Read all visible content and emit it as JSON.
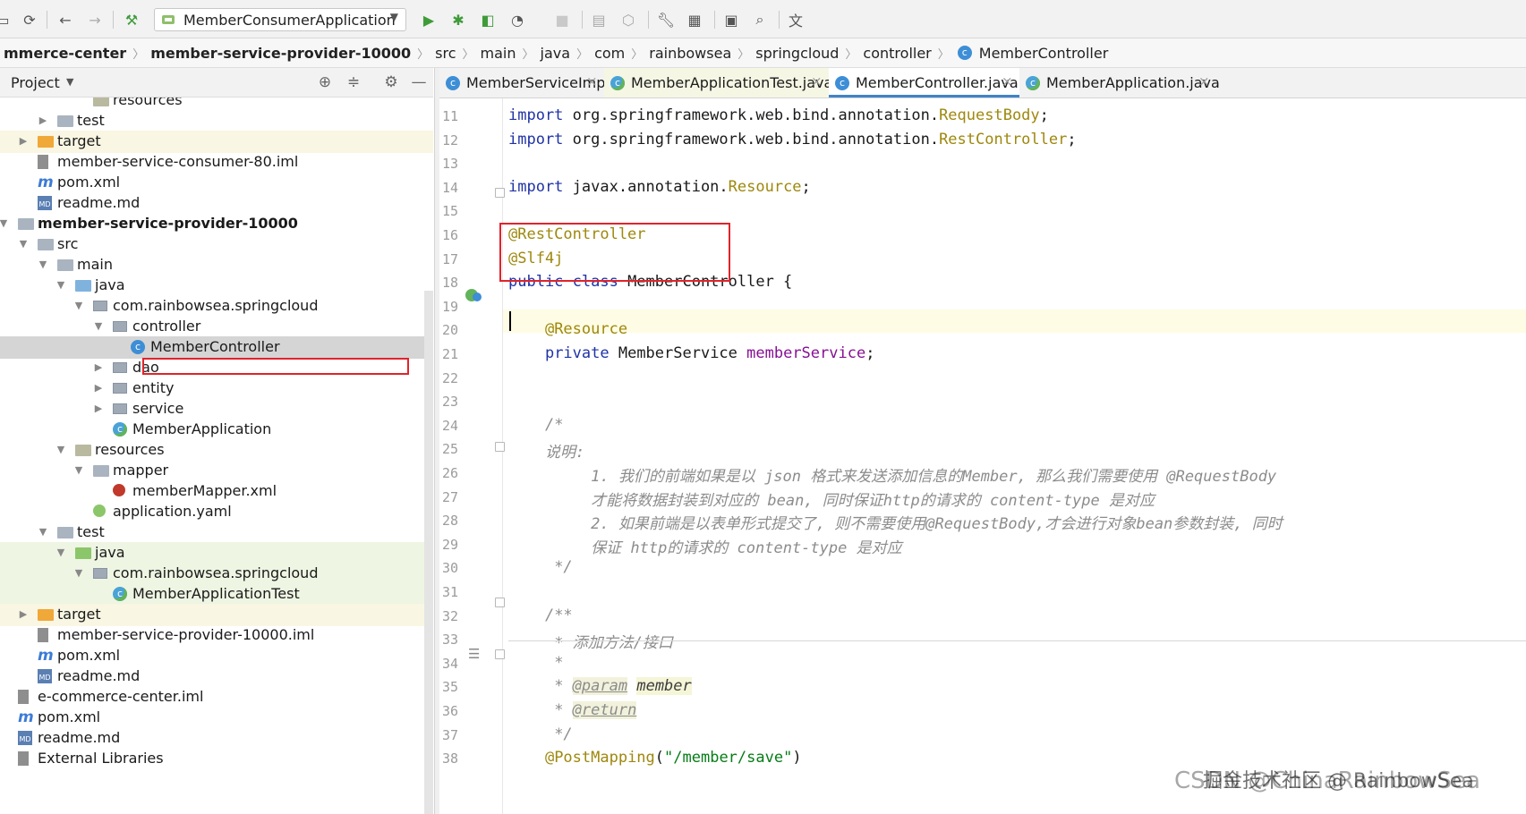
{
  "toolbar": {
    "run_config": "MemberConsumerApplication",
    "icons": [
      "save-all-icon",
      "sync-icon",
      "back-icon",
      "forward-icon",
      "build-icon",
      "run-icon",
      "debug-icon",
      "coverage-icon",
      "profile-icon",
      "stop-icon",
      "attach-icon",
      "deploy-icon",
      "settings-icon",
      "project-structure-icon",
      "terminal-icon",
      "search-icon",
      "translate-icon"
    ]
  },
  "breadcrumb": [
    "mmerce-center",
    "member-service-provider-10000",
    "src",
    "main",
    "java",
    "com",
    "rainbowsea",
    "springcloud",
    "controller",
    "MemberController"
  ],
  "project": {
    "title": "Project",
    "tree": [
      {
        "label": "resources",
        "depth": 4,
        "icon": "res",
        "arrow": ""
      },
      {
        "label": "test",
        "depth": 2,
        "icon": "folder",
        "arrow": "right"
      },
      {
        "label": "target",
        "depth": 1,
        "icon": "target",
        "arrow": "right",
        "hl": "target"
      },
      {
        "label": "member-service-consumer-80.iml",
        "depth": 1,
        "icon": "file",
        "arrow": ""
      },
      {
        "label": "pom.xml",
        "depth": 1,
        "icon": "m",
        "arrow": ""
      },
      {
        "label": "readme.md",
        "depth": 1,
        "icon": "md",
        "arrow": ""
      },
      {
        "label": "member-service-provider-10000",
        "depth": 0,
        "icon": "folder",
        "arrow": "down",
        "bold": true
      },
      {
        "label": "src",
        "depth": 1,
        "icon": "folder",
        "arrow": "down"
      },
      {
        "label": "main",
        "depth": 2,
        "icon": "folder",
        "arrow": "down"
      },
      {
        "label": "java",
        "depth": 3,
        "icon": "src",
        "arrow": "down"
      },
      {
        "label": "com.rainbowsea.springcloud",
        "depth": 4,
        "icon": "pkg",
        "arrow": "down"
      },
      {
        "label": "controller",
        "depth": 5,
        "icon": "pkg",
        "arrow": "down"
      },
      {
        "label": "MemberController",
        "depth": 6,
        "icon": "class",
        "arrow": "",
        "selected": true
      },
      {
        "label": "dao",
        "depth": 5,
        "icon": "pkg",
        "arrow": "right"
      },
      {
        "label": "entity",
        "depth": 5,
        "icon": "pkg",
        "arrow": "right"
      },
      {
        "label": "service",
        "depth": 5,
        "icon": "pkg",
        "arrow": "right"
      },
      {
        "label": "MemberApplication",
        "depth": 5,
        "icon": "spring",
        "arrow": ""
      },
      {
        "label": "resources",
        "depth": 3,
        "icon": "res",
        "arrow": "down"
      },
      {
        "label": "mapper",
        "depth": 4,
        "icon": "folder",
        "arrow": "down"
      },
      {
        "label": "memberMapper.xml",
        "depth": 5,
        "icon": "xml",
        "arrow": ""
      },
      {
        "label": "application.yaml",
        "depth": 4,
        "icon": "yaml",
        "arrow": ""
      },
      {
        "label": "test",
        "depth": 2,
        "icon": "folder",
        "arrow": "down"
      },
      {
        "label": "java",
        "depth": 3,
        "icon": "test",
        "arrow": "down",
        "hl": "test"
      },
      {
        "label": "com.rainbowsea.springcloud",
        "depth": 4,
        "icon": "pkg",
        "arrow": "down",
        "hl": "test"
      },
      {
        "label": "MemberApplicationTest",
        "depth": 5,
        "icon": "spring",
        "arrow": "",
        "hl": "test"
      },
      {
        "label": "target",
        "depth": 1,
        "icon": "target",
        "arrow": "right",
        "hl": "target"
      },
      {
        "label": "member-service-provider-10000.iml",
        "depth": 1,
        "icon": "file",
        "arrow": ""
      },
      {
        "label": "pom.xml",
        "depth": 1,
        "icon": "m",
        "arrow": ""
      },
      {
        "label": "readme.md",
        "depth": 1,
        "icon": "md",
        "arrow": ""
      },
      {
        "label": "e-commerce-center.iml",
        "depth": 0,
        "icon": "file",
        "arrow": ""
      },
      {
        "label": "pom.xml",
        "depth": 0,
        "icon": "m",
        "arrow": ""
      },
      {
        "label": "readme.md",
        "depth": 0,
        "icon": "md",
        "arrow": ""
      },
      {
        "label": "External Libraries",
        "depth": 0,
        "icon": "lib",
        "arrow": ""
      }
    ]
  },
  "tabs": [
    {
      "label": "MemberServiceImpl.java",
      "icon": "class",
      "state": "normal"
    },
    {
      "label": "MemberApplicationTest.java",
      "icon": "spring",
      "state": "modified"
    },
    {
      "label": "MemberController.java",
      "icon": "class",
      "state": "active"
    },
    {
      "label": "MemberApplication.java",
      "icon": "spring",
      "state": "normal"
    }
  ],
  "editor": {
    "line_numbers": [
      "11",
      "12",
      "13",
      "14",
      "15",
      "16",
      "17",
      "18",
      "19",
      "20",
      "21",
      "22",
      "23",
      "24",
      "25",
      "26",
      "27",
      "28",
      "29",
      "30",
      "31",
      "32",
      "33",
      "34",
      "35",
      "36",
      "37",
      "38"
    ],
    "lines": [
      [
        {
          "t": "import",
          "c": "kw"
        },
        {
          "t": " org.springframework.web.bind.annotation."
        },
        {
          "t": "RequestBody",
          "c": "ann"
        },
        {
          "t": ";"
        }
      ],
      [
        {
          "t": "import",
          "c": "kw"
        },
        {
          "t": " org.springframework.web.bind.annotation."
        },
        {
          "t": "RestController",
          "c": "ann"
        },
        {
          "t": ";"
        }
      ],
      [],
      [
        {
          "t": "import",
          "c": "kw"
        },
        {
          "t": " javax.annotation."
        },
        {
          "t": "Resource",
          "c": "ann"
        },
        {
          "t": ";"
        }
      ],
      [],
      [
        {
          "t": "@RestController",
          "c": "ann"
        }
      ],
      [
        {
          "t": "@Slf4j",
          "c": "ann"
        }
      ],
      [
        {
          "t": "public class",
          "c": "kw"
        },
        {
          "t": " MemberController {"
        }
      ],
      [],
      [
        {
          "t": "    "
        },
        {
          "t": "@Resource",
          "c": "ann"
        }
      ],
      [
        {
          "t": "    "
        },
        {
          "t": "private",
          "c": "kw"
        },
        {
          "t": " MemberService "
        },
        {
          "t": "memberService",
          "c": "fld"
        },
        {
          "t": ";"
        }
      ],
      [],
      [],
      [
        {
          "t": "    "
        },
        {
          "t": "/*",
          "c": "cmt"
        }
      ],
      [
        {
          "t": "    "
        },
        {
          "t": "说明:",
          "c": "cmt"
        }
      ],
      [
        {
          "t": "         "
        },
        {
          "t": "1. 我们的前端如果是以 json 格式来发送添加信息的Member, 那么我们需要使用 @RequestBody",
          "c": "cmt"
        }
      ],
      [
        {
          "t": "         "
        },
        {
          "t": "才能将数据封装到对应的 bean, 同时保证http的请求的 content-type 是对应",
          "c": "cmt"
        }
      ],
      [
        {
          "t": "         "
        },
        {
          "t": "2. 如果前端是以表单形式提交了, 则不需要使用@RequestBody,才会进行对象bean参数封装, 同时",
          "c": "cmt"
        }
      ],
      [
        {
          "t": "         "
        },
        {
          "t": "保证 http的请求的 content-type 是对应",
          "c": "cmt"
        }
      ],
      [
        {
          "t": "     "
        },
        {
          "t": "*/",
          "c": "cmt"
        }
      ],
      [],
      [
        {
          "t": "    "
        },
        {
          "t": "/**",
          "c": "cmt"
        }
      ],
      [
        {
          "t": "     "
        },
        {
          "t": "* 添加方法/接口",
          "c": "cmt"
        }
      ],
      [
        {
          "t": "     "
        },
        {
          "t": "*",
          "c": "cmt"
        }
      ],
      [
        {
          "t": "     "
        },
        {
          "t": "* ",
          "c": "cmt"
        },
        {
          "t": "@param",
          "c": "tag"
        },
        {
          "t": " "
        },
        {
          "t": "member",
          "c": "tagval"
        }
      ],
      [
        {
          "t": "     "
        },
        {
          "t": "* ",
          "c": "cmt"
        },
        {
          "t": "@return",
          "c": "tag"
        }
      ],
      [
        {
          "t": "     "
        },
        {
          "t": "*/",
          "c": "cmt"
        }
      ],
      [
        {
          "t": "    "
        },
        {
          "t": "@PostMapping",
          "c": "ann"
        },
        {
          "t": "("
        },
        {
          "t": "\"/member/save\"",
          "c": "str"
        },
        {
          "t": ")"
        }
      ]
    ]
  },
  "watermark": "CSDN @ChinaRainbowSea",
  "watermark_cn": "掘金技术社区 @ RainbowSea"
}
